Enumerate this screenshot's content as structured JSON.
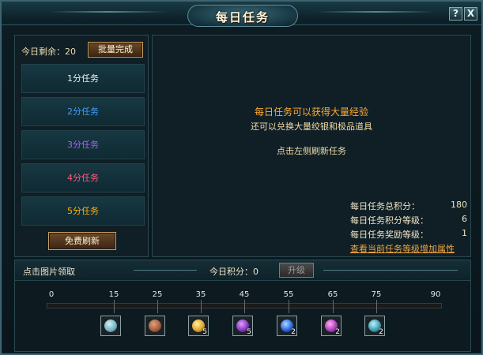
{
  "window": {
    "title": "每日任务",
    "help_label": "?",
    "close_label": "X"
  },
  "left": {
    "remaining_label": "今日剩余：20",
    "batch_complete_label": "批量完成",
    "tasks": [
      {
        "label": "1分任务",
        "color": "#f0f0f0"
      },
      {
        "label": "2分任务",
        "color": "#3aa0ff"
      },
      {
        "label": "3分任务",
        "color": "#b45cff"
      },
      {
        "label": "4分任务",
        "color": "#ff5a7a"
      },
      {
        "label": "5分任务",
        "color": "#ffb000"
      }
    ],
    "free_refresh_label": "免费刷新"
  },
  "right": {
    "intro_line1": "每日任务可以获得大量经验",
    "intro_line2": "还可以兑换大量绞银和极品道具",
    "intro_line3": "点击左侧刷新任务",
    "stats": [
      {
        "label": "每日任务总积分：",
        "value": "180"
      },
      {
        "label": "每日任务积分等级：",
        "value": "6"
      },
      {
        "label": "每日任务奖励等级：",
        "value": "1"
      }
    ],
    "link_label": "查看当前任务等级增加属性"
  },
  "rewards_bar": {
    "click_hint": "点击图片领取",
    "today_score_label": "今日积分：0",
    "upgrade_label": "升级",
    "milestones": [
      "0",
      "15",
      "25",
      "35",
      "45",
      "55",
      "65",
      "75",
      "90"
    ],
    "items": [
      {
        "icon": "potion-bottle-icon",
        "count": "",
        "color": "#6fb0c0"
      },
      {
        "icon": "ore-pile-icon",
        "count": "",
        "color": "#a05a3a"
      },
      {
        "icon": "gold-coin-icon",
        "count": "5",
        "color": "#e0a830"
      },
      {
        "icon": "purple-scroll-icon",
        "count": "5",
        "color": "#8a3ac0"
      },
      {
        "icon": "blue-gem-icon",
        "count": "2",
        "color": "#2a6ae0"
      },
      {
        "icon": "purple-gem-icon",
        "count": "2",
        "color": "#b040c0"
      },
      {
        "icon": "teal-orb-icon",
        "count": "2",
        "color": "#40a0b0"
      }
    ]
  }
}
